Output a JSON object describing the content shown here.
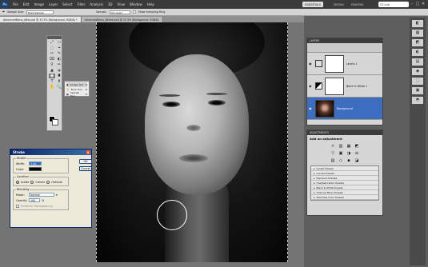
{
  "menubar": {
    "logo": "Ps",
    "items": [
      "File",
      "Edit",
      "Image",
      "Layer",
      "Select",
      "Filter",
      "Analysis",
      "3D",
      "View",
      "Window",
      "Help"
    ],
    "workspaces": [
      "ESSENTIALS",
      "DESIGN",
      "PAINTING"
    ],
    "cs_live": "CS Live",
    "window_controls": [
      "–",
      "□",
      "✕"
    ]
  },
  "options": {
    "sample_size_label": "Sample Size:",
    "sample_size_value": "Point Sample",
    "sample_label": "Sample:",
    "sample_value": "All Layers",
    "show_ring_label": "Show Sampling Ring"
  },
  "tabs": [
    {
      "label": "AdvancedMono_After.psd @ 33.3% (Background, RGB/8) *",
      "active": true
    },
    {
      "label": "AdvancedMono_Before.psd @ 33.3% (Background, RGB/8)",
      "active": false
    }
  ],
  "tools": {
    "icons": [
      "⤢",
      "▭",
      "◌",
      "⌖",
      "✂",
      "✎",
      "⌧",
      "◐",
      "⚲",
      "✏",
      "▲",
      "⬙",
      "◉",
      "⬮",
      "T",
      "⬆",
      "✋",
      "🔍"
    ],
    "flyout": [
      {
        "label": "Dodge Tool",
        "shortcut": "O",
        "selected": true
      },
      {
        "label": "Burn Tool",
        "shortcut": "O",
        "selected": false
      },
      {
        "label": "Sponge Tool",
        "shortcut": "O",
        "selected": false
      }
    ]
  },
  "dialog": {
    "title": "Stroke",
    "close": "x",
    "stroke_legend": "Stroke",
    "width_label": "Width:",
    "width_value": "1 px",
    "color_label": "Color:",
    "location_legend": "Location",
    "locations": [
      "Inside",
      "Center",
      "Outside"
    ],
    "blending_legend": "Blending",
    "mode_label": "Mode:",
    "mode_value": "Normal",
    "opacity_label": "Opacity:",
    "opacity_value": "100",
    "opacity_unit": "%",
    "preserve_label": "Preserve Transparency",
    "ok": "OK",
    "cancel": "Cancel",
    "accent": "#0a246a"
  },
  "layers": {
    "panel_tabs": [
      "LAYERS",
      "CHANNELS",
      "PATHS"
    ],
    "rows": [
      {
        "name": "Levels 1",
        "selected": false
      },
      {
        "name": "Black & White 1",
        "selected": false
      },
      {
        "name": "Background",
        "selected": true
      }
    ],
    "select_color": "#3d6dbf"
  },
  "adjustments": {
    "panel_tabs": [
      "ADJUSTMENTS",
      "MASKS"
    ],
    "heading": "Add an adjustment",
    "icons": [
      "☼",
      "▥",
      "▦",
      "◩",
      "▽",
      "▣",
      "◑",
      "⚖",
      "▤",
      "◇",
      "▪",
      "◪"
    ],
    "presets": [
      "Levels Presets",
      "Curves Presets",
      "Exposure Presets",
      "Hue/Saturation Presets",
      "Black & White Presets",
      "Channel Mixer Presets",
      "Selective Color Presets"
    ]
  },
  "iconstrip": [
    "◧",
    "▦",
    "◩",
    "◐",
    "▤",
    "◆",
    "⬚",
    "▣",
    "◓"
  ]
}
